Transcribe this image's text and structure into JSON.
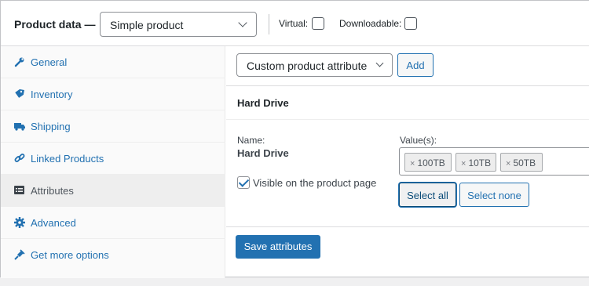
{
  "header": {
    "title": "Product data —",
    "product_type": "Simple product",
    "virtual_label": "Virtual:",
    "downloadable_label": "Downloadable:"
  },
  "tabs": [
    {
      "label": "General",
      "icon": "wrench-icon"
    },
    {
      "label": "Inventory",
      "icon": "tag-icon"
    },
    {
      "label": "Shipping",
      "icon": "truck-icon"
    },
    {
      "label": "Linked Products",
      "icon": "link-icon"
    },
    {
      "label": "Attributes",
      "icon": "list-icon",
      "active": true
    },
    {
      "label": "Advanced",
      "icon": "gear-icon"
    },
    {
      "label": "Get more options",
      "icon": "plugin-icon"
    }
  ],
  "attributes": {
    "select_value": "Custom product attribute",
    "add_label": "Add",
    "attribute_title": "Hard Drive",
    "name_label": "Name:",
    "name_value": "Hard Drive",
    "values_label": "Value(s):",
    "values": [
      "100TB",
      "10TB",
      "50TB"
    ],
    "chip_remove": "×",
    "visible_label": "Visible on the product page",
    "select_all_label": "Select all",
    "select_none_label": "Select none",
    "save_label": "Save attributes"
  },
  "colors": {
    "accent": "#2271b1",
    "border": "#c3c4c7",
    "active_tab_bg": "#eeeeee"
  }
}
